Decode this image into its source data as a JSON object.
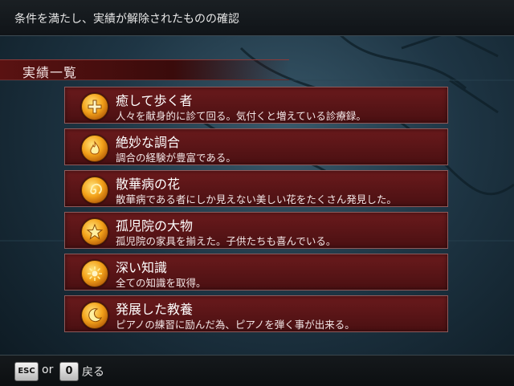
{
  "header": {
    "help_text": "条件を満たし、実績が解除されたものの確認"
  },
  "section": {
    "title": "実績一覧"
  },
  "achievements": [
    {
      "name": "癒して歩く者",
      "description": "人々を献身的に診て回る。気付くと増えている診療録。",
      "icon": "cross-icon"
    },
    {
      "name": "絶妙な調合",
      "description": "調合の経験が豊富である。",
      "icon": "flame-icon"
    },
    {
      "name": "散華病の花",
      "description": "散華病である者にしか見えない美しい花をたくさん発見した。",
      "icon": "swirl-icon"
    },
    {
      "name": "孤児院の大物",
      "description": "孤児院の家具を揃えた。子供たちも喜んでいる。",
      "icon": "star-icon"
    },
    {
      "name": "深い知識",
      "description": "全ての知識を取得。",
      "icon": "sunburst-icon"
    },
    {
      "name": "発展した教養",
      "description": "ピアノの練習に励んだ為、ピアノを弾く事が出来る。",
      "icon": "crescent-icon"
    }
  ],
  "footer": {
    "key_esc": "ESC",
    "or_text": "or",
    "key_zero": "0",
    "back_label": "戻る"
  },
  "colors": {
    "item_bg": "#5a1416",
    "item_border": "#8f5a5a",
    "icon_gold": "#f3a21a",
    "header_red": "#5a1212"
  }
}
